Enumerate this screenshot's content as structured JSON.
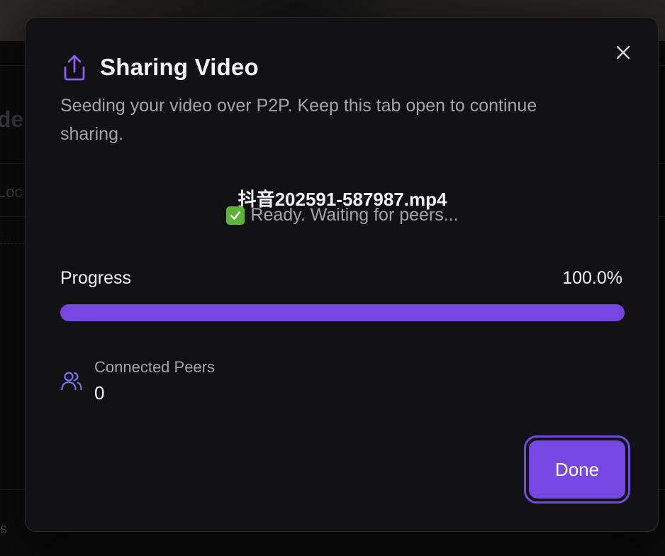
{
  "background": {
    "heading_fragment": "de",
    "label_fragment": "Loc",
    "footer_fragment": "s"
  },
  "dialog": {
    "title": "Sharing Video",
    "title_icon": "share-upload-icon",
    "close_icon": "close-icon",
    "subtitle": "Seeding your video over P2P. Keep this tab open to continue sharing.",
    "file_name": "抖音202591-587987.mp4",
    "status_icon": "check-mark-button-icon",
    "status_text": "Ready. Waiting for peers...",
    "progress": {
      "label": "Progress",
      "value_text": "100.0%",
      "fraction": 1.0
    },
    "peers": {
      "icon": "users-icon",
      "label": "Connected Peers",
      "count": "0"
    },
    "done_label": "Done"
  },
  "colors": {
    "accent": "#7447e3",
    "status_check": "#5fb336",
    "modal_bg": "#111113"
  }
}
